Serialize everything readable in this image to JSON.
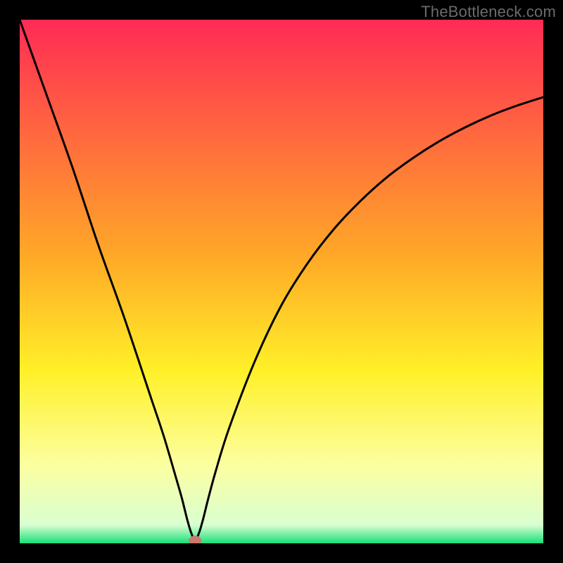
{
  "watermark": "TheBottleneck.com",
  "chart_data": {
    "type": "line",
    "title": "",
    "xlabel": "",
    "ylabel": "",
    "xlim": [
      0,
      100
    ],
    "ylim": [
      0,
      100
    ],
    "grid": false,
    "background_gradient": [
      {
        "offset": 0.0,
        "color": "#ff2b55"
      },
      {
        "offset": 0.45,
        "color": "#ffa827"
      },
      {
        "offset": 0.67,
        "color": "#fff028"
      },
      {
        "offset": 0.85,
        "color": "#fcffa0"
      },
      {
        "offset": 0.965,
        "color": "#d9ffd1"
      },
      {
        "offset": 1.0,
        "color": "#18e07a"
      }
    ],
    "series": [
      {
        "name": "bottleneck-curve",
        "x": [
          0,
          5,
          10,
          15,
          20,
          25,
          27.5,
          30,
          31,
          32,
          32.75,
          33.5,
          34.25,
          35,
          36,
          37.5,
          40,
          45,
          50,
          55,
          60,
          65,
          70,
          75,
          80,
          85,
          90,
          95,
          100
        ],
        "y": [
          100,
          86,
          72,
          57,
          43,
          28,
          20.5,
          12,
          8.5,
          4.5,
          2,
          0.5,
          2,
          4.5,
          8.5,
          14,
          22,
          35,
          45.5,
          53.5,
          60,
          65.3,
          69.8,
          73.5,
          76.7,
          79.4,
          81.7,
          83.6,
          85.2
        ]
      }
    ],
    "marker": {
      "name": "optimal-point",
      "x": 33.5,
      "y": 0.5,
      "color": "#c97a6d",
      "rx": 9,
      "ry": 7
    }
  }
}
